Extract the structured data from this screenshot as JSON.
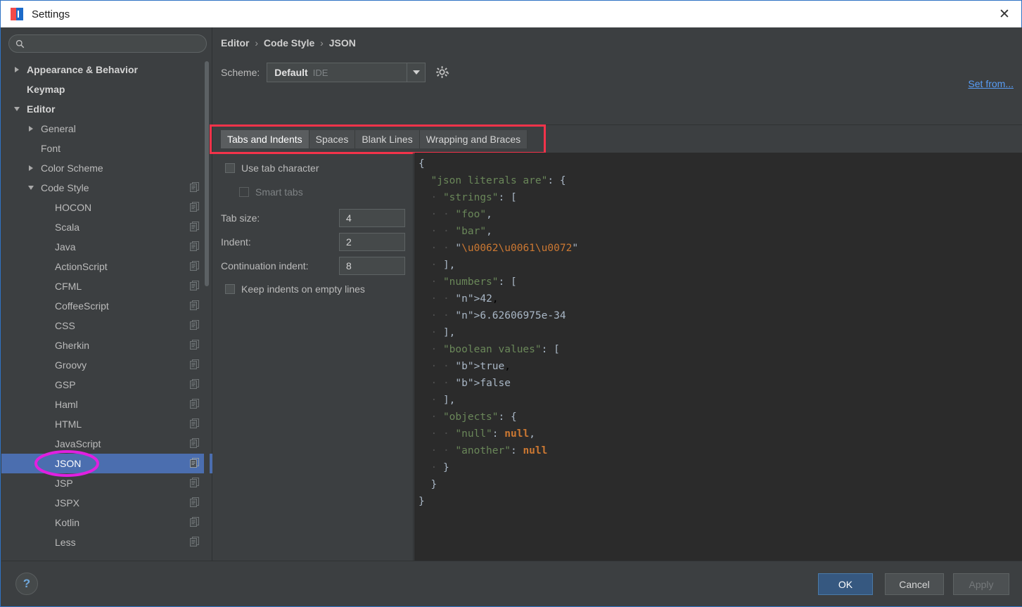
{
  "window": {
    "title": "Settings",
    "close_label": "✕",
    "app_icon": "intellij-idea-icon"
  },
  "sidebar": {
    "search": {
      "value": "",
      "placeholder": ""
    },
    "items": [
      {
        "label": "Appearance & Behavior",
        "indent": 0,
        "twisty": "right",
        "bold": true,
        "copy": false,
        "selected": false
      },
      {
        "label": "Keymap",
        "indent": 0,
        "twisty": "none",
        "bold": true,
        "copy": false,
        "selected": false
      },
      {
        "label": "Editor",
        "indent": 0,
        "twisty": "down",
        "bold": true,
        "copy": false,
        "selected": false
      },
      {
        "label": "General",
        "indent": 1,
        "twisty": "right",
        "bold": false,
        "copy": false,
        "selected": false
      },
      {
        "label": "Font",
        "indent": 1,
        "twisty": "none",
        "bold": false,
        "copy": false,
        "selected": false
      },
      {
        "label": "Color Scheme",
        "indent": 1,
        "twisty": "right",
        "bold": false,
        "copy": false,
        "selected": false
      },
      {
        "label": "Code Style",
        "indent": 1,
        "twisty": "down",
        "bold": false,
        "copy": true,
        "selected": false
      },
      {
        "label": "HOCON",
        "indent": 2,
        "twisty": "none",
        "bold": false,
        "copy": true,
        "selected": false
      },
      {
        "label": "Scala",
        "indent": 2,
        "twisty": "none",
        "bold": false,
        "copy": true,
        "selected": false
      },
      {
        "label": "Java",
        "indent": 2,
        "twisty": "none",
        "bold": false,
        "copy": true,
        "selected": false
      },
      {
        "label": "ActionScript",
        "indent": 2,
        "twisty": "none",
        "bold": false,
        "copy": true,
        "selected": false
      },
      {
        "label": "CFML",
        "indent": 2,
        "twisty": "none",
        "bold": false,
        "copy": true,
        "selected": false
      },
      {
        "label": "CoffeeScript",
        "indent": 2,
        "twisty": "none",
        "bold": false,
        "copy": true,
        "selected": false
      },
      {
        "label": "CSS",
        "indent": 2,
        "twisty": "none",
        "bold": false,
        "copy": true,
        "selected": false
      },
      {
        "label": "Gherkin",
        "indent": 2,
        "twisty": "none",
        "bold": false,
        "copy": true,
        "selected": false
      },
      {
        "label": "Groovy",
        "indent": 2,
        "twisty": "none",
        "bold": false,
        "copy": true,
        "selected": false
      },
      {
        "label": "GSP",
        "indent": 2,
        "twisty": "none",
        "bold": false,
        "copy": true,
        "selected": false
      },
      {
        "label": "Haml",
        "indent": 2,
        "twisty": "none",
        "bold": false,
        "copy": true,
        "selected": false
      },
      {
        "label": "HTML",
        "indent": 2,
        "twisty": "none",
        "bold": false,
        "copy": true,
        "selected": false
      },
      {
        "label": "JavaScript",
        "indent": 2,
        "twisty": "none",
        "bold": false,
        "copy": true,
        "selected": false
      },
      {
        "label": "JSON",
        "indent": 2,
        "twisty": "none",
        "bold": false,
        "copy": true,
        "selected": true
      },
      {
        "label": "JSP",
        "indent": 2,
        "twisty": "none",
        "bold": false,
        "copy": true,
        "selected": false
      },
      {
        "label": "JSPX",
        "indent": 2,
        "twisty": "none",
        "bold": false,
        "copy": true,
        "selected": false
      },
      {
        "label": "Kotlin",
        "indent": 2,
        "twisty": "none",
        "bold": false,
        "copy": true,
        "selected": false
      },
      {
        "label": "Less",
        "indent": 2,
        "twisty": "none",
        "bold": false,
        "copy": true,
        "selected": false
      }
    ]
  },
  "header": {
    "breadcrumb": {
      "root": "Editor",
      "mid": "Code Style",
      "leaf": "JSON",
      "separator": "›"
    },
    "scheme": {
      "label": "Scheme:",
      "value": "Default",
      "scope": "IDE"
    },
    "set_from_label": "Set from..."
  },
  "tabs": [
    {
      "label": "Tabs and Indents",
      "active": true
    },
    {
      "label": "Spaces",
      "active": false
    },
    {
      "label": "Blank Lines",
      "active": false
    },
    {
      "label": "Wrapping and Braces",
      "active": false
    }
  ],
  "form": {
    "use_tab_character": {
      "label": "Use tab character",
      "checked": false,
      "disabled": false
    },
    "smart_tabs": {
      "label": "Smart tabs",
      "checked": false,
      "disabled": true
    },
    "tab_size": {
      "label": "Tab size:",
      "value": "4"
    },
    "indent": {
      "label": "Indent:",
      "value": "2"
    },
    "continuation_indent": {
      "label": "Continuation indent:",
      "value": "8"
    },
    "keep_indents": {
      "label": "Keep indents on empty lines",
      "checked": false,
      "disabled": false
    }
  },
  "preview": {
    "language": "JSON",
    "code_lines": [
      "{",
      "  \"json literals are\": {",
      "    \"strings\": [",
      "      \"foo\",",
      "      \"bar\",",
      "      \"\\u0062\\u0061\\u0072\"",
      "    ],",
      "    \"numbers\": [",
      "      42,",
      "      6.62606975e-34",
      "    ],",
      "    \"boolean values\": [",
      "      true,",
      "      false",
      "    ],",
      "    \"objects\": {",
      "      \"null\": null,",
      "      \"another\": null",
      "    }",
      "  }",
      "}"
    ]
  },
  "footer": {
    "help_label": "?",
    "ok_label": "OK",
    "cancel_label": "Cancel",
    "apply_label": "Apply"
  },
  "annotations": {
    "tabs_box_color": "#f4334a",
    "json_ellipse_color": "#e020e0"
  },
  "colors": {
    "dialog_bg": "#3c3f41",
    "editor_bg": "#2b2b2b",
    "selection_blue": "#4b6eaf",
    "primary_button": "#365880",
    "link_blue": "#589df6"
  }
}
